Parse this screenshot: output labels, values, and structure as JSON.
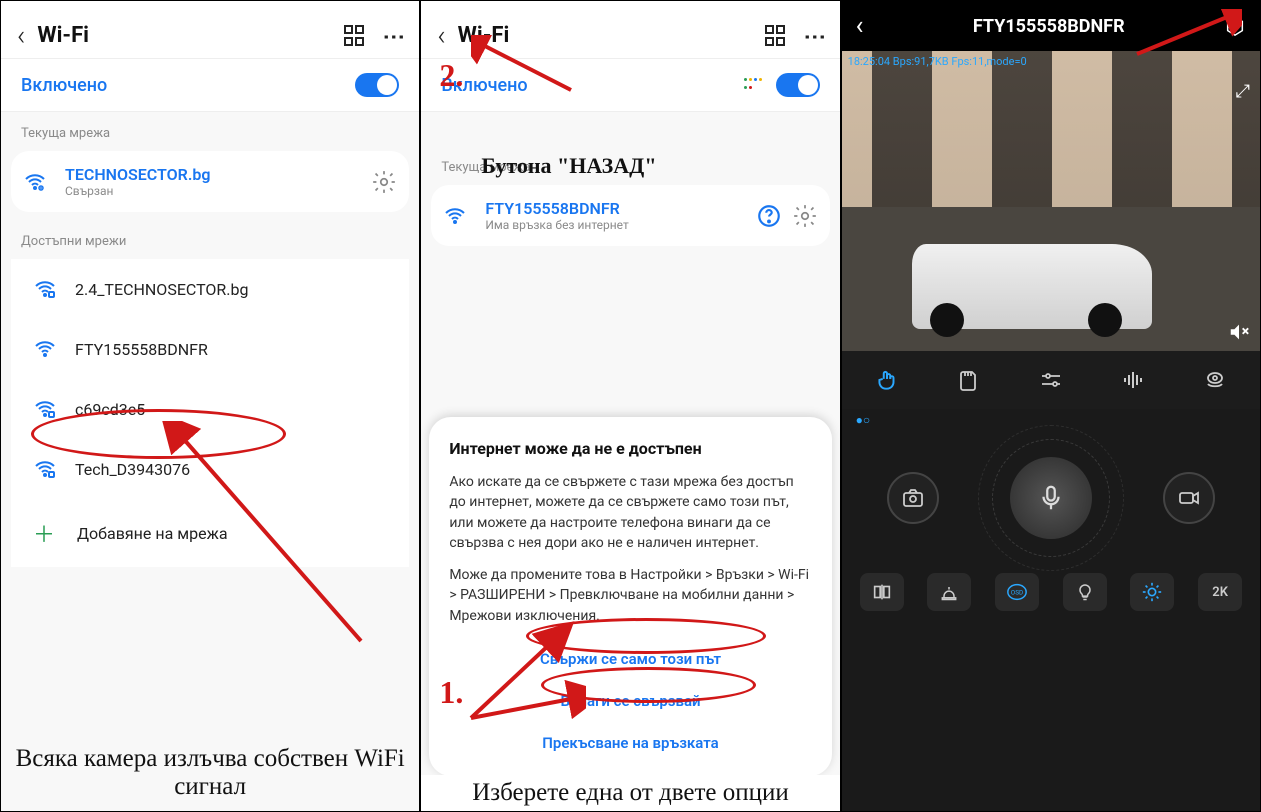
{
  "screen1": {
    "title": "Wi-Fi",
    "enabled_label": "Включено",
    "current_net_label": "Текуща мрежа",
    "current_net": {
      "name": "TECHNOSECTOR.bg",
      "status": "Свързан"
    },
    "available_label": "Достъпни мрежи",
    "networks": [
      {
        "name": "2.4_TECHNOSECTOR.bg"
      },
      {
        "name": "FTY155558BDNFR"
      },
      {
        "name": "c69cd3e5"
      },
      {
        "name": "Tech_D3943076"
      }
    ],
    "add_network": "Добавяне на мрежа",
    "caption": "Всяка камера излъчва собствен WiFi сигнал"
  },
  "screen2": {
    "title": "Wi-Fi",
    "enabled_label": "Включено",
    "back_caption": "Бутона \"НАЗАД\"",
    "current_net_label": "Текуща мрежа",
    "current_net": {
      "name": "FTY155558BDNFR",
      "status": "Има връзка без интернет"
    },
    "popup": {
      "heading": "Интернет може да не е достъпен",
      "p1": "Ако искате да се свържете с тази мрежа без достъп до интернет, можете да се свържете само този път, или можете да настроите телефона винаги да се свързва с нея дори ако не е наличен интернет.",
      "p2": "Може да промените това в Настройки > Връзки > Wi-Fi > РАЗШИРЕНИ > Превключване на мобилни данни > Мрежови изключения.",
      "opt1": "Свържи се само този път",
      "opt2": "Винаги се свързвай",
      "opt3": "Прекъсване на връзката"
    },
    "footer_caption": "Изберете една от двете опции",
    "marker1": "1.",
    "marker2": "2."
  },
  "screen3": {
    "title": "FTY155558BDNFR",
    "overlay": "18:25:04  Bps:91,7KB  Fps:11,mode=0",
    "quality": "2K"
  }
}
